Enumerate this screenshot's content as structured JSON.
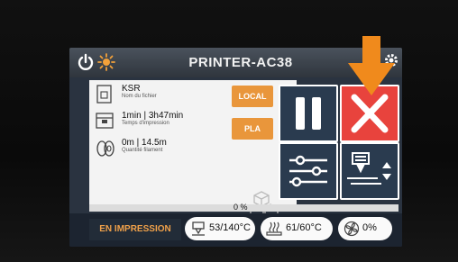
{
  "header": {
    "title": "PRINTER-AC38",
    "icons": [
      "power-icon",
      "sun-icon",
      "gear-icon"
    ]
  },
  "file": {
    "name": "KSR",
    "name_label": "Nom du fichier",
    "time": "1min | 3h47min",
    "time_label": "Temps d'impression",
    "filament": "0m | 14.5m",
    "filament_label": "Quantité filament"
  },
  "tags": {
    "source": "LOCAL",
    "material": "PLA"
  },
  "controls": {
    "pause_icon": "pause-icon",
    "stop_icon": "close-icon",
    "tune_icon": "sliders-icon",
    "z_icon": "nozzle-z-icon"
  },
  "progress": {
    "label": "0 %",
    "value": 0
  },
  "status": {
    "state": "EN IMPRESSION",
    "nozzle_temp": "53/140°C",
    "bed_temp": "61/60°C",
    "fan": "0%"
  },
  "colors": {
    "accent_orange": "#e9963b",
    "stop_red": "#e8433d",
    "panel_dark": "#2a3b4f",
    "arrow": "#f08a1c"
  }
}
